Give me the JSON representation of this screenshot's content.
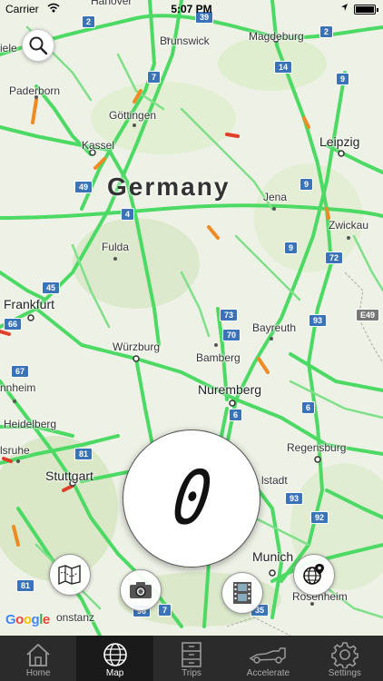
{
  "status_bar": {
    "carrier": "Carrier",
    "time": "5:07 PM",
    "battery_level": 1.0
  },
  "map": {
    "country_label": "Germany",
    "cities": {
      "hanover": "Hanover",
      "brunswick": "Brunswick",
      "magdeburg": "Magdeburg",
      "paderborn": "Paderborn",
      "gottingen": "Göttingen",
      "kassel": "Kassel",
      "leipzig": "Leipzig",
      "jena": "Jena",
      "zwickau": "Zwickau",
      "fulda": "Fulda",
      "frankfurt": "Frankfurt",
      "bayreuth": "Bayreuth",
      "wurzburg": "Würzburg",
      "bamberg": "Bamberg",
      "nuremberg": "Nuremberg",
      "mannheim": "nnheim",
      "heidelberg": "Heidelberg",
      "regensburg": "Regensburg",
      "karlsruhe": "lsruhe",
      "stuttgart": "Stuttgart",
      "ingolstadt": "lstadt",
      "munich": "Munich",
      "rosenheim": "Rosenheim",
      "konstanz": "onstanz",
      "bielefeld": "iele"
    },
    "road_shields": [
      "2",
      "39",
      "2",
      "14",
      "7",
      "9",
      "49",
      "9",
      "4",
      "9",
      "72",
      "45",
      "73",
      "66",
      "70",
      "93",
      "67",
      "6",
      "6",
      "81",
      "93",
      "92",
      "81",
      "96",
      "7",
      "35",
      "E49"
    ],
    "attribution": "Google"
  },
  "speedometer": {
    "value": "0"
  },
  "tabs": [
    {
      "label": "Home",
      "icon": "home-icon",
      "active": false
    },
    {
      "label": "Map",
      "icon": "globe-icon",
      "active": true
    },
    {
      "label": "Trips",
      "icon": "cabinet-icon",
      "active": false
    },
    {
      "label": "Accelerate",
      "icon": "race-car-icon",
      "active": false
    },
    {
      "label": "Settings",
      "icon": "gear-icon",
      "active": false
    }
  ],
  "colors": {
    "road_green": "#4cd964",
    "road_orange": "#f08a24",
    "road_red": "#e0402a",
    "tabbar": "#2b2b2b"
  }
}
